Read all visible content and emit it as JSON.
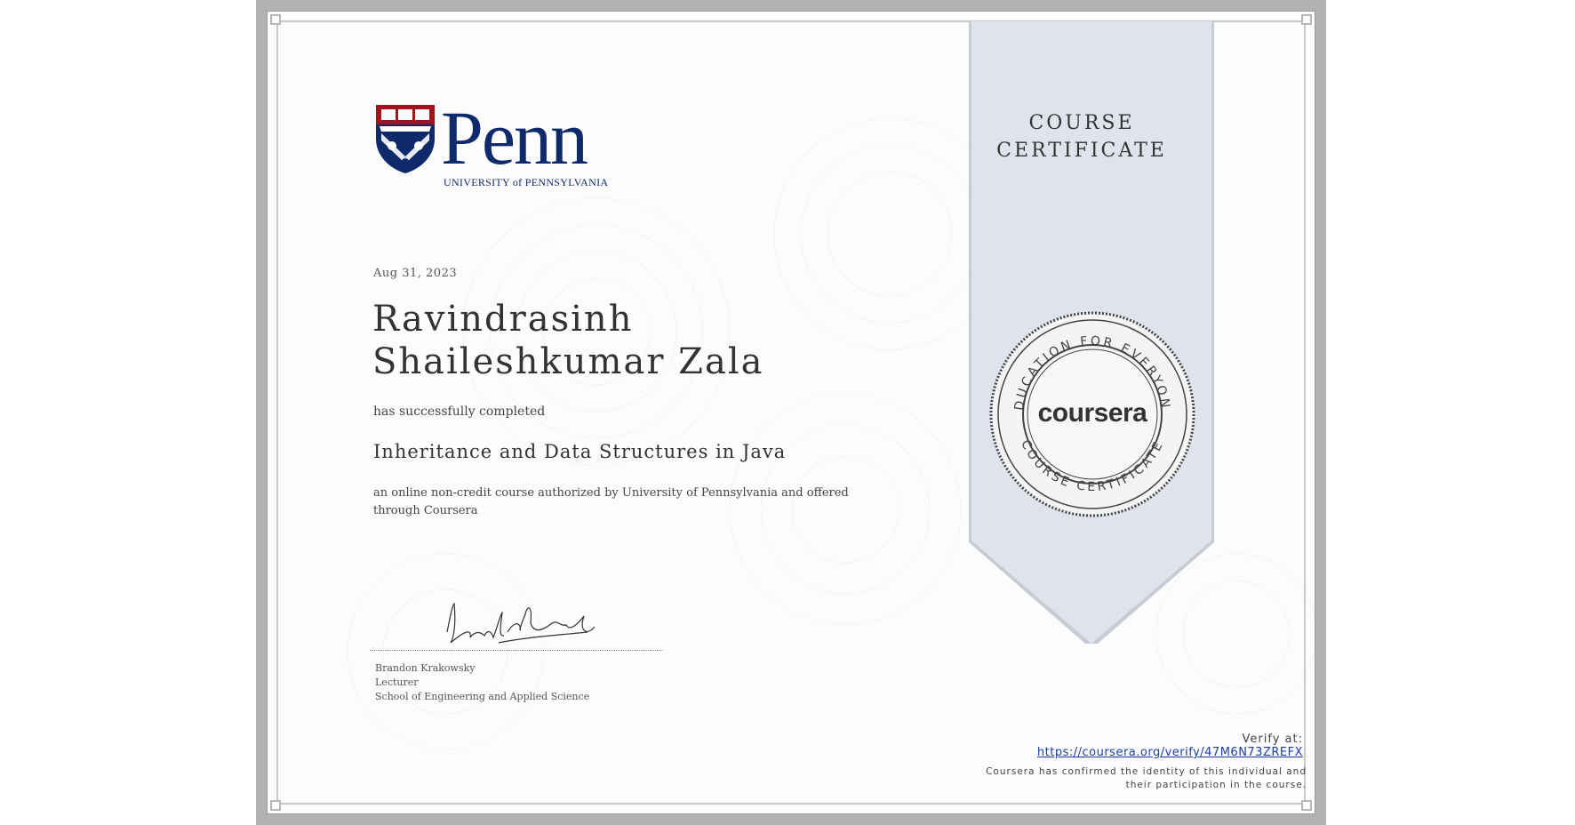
{
  "institution": {
    "logo_word": "Penn",
    "logo_subtitle": "UNIVERSITY of PENNSYLVANIA",
    "shield_colors": {
      "navy": "#0f2a6b",
      "red": "#a1121b"
    }
  },
  "certificate": {
    "issue_date": "Aug 31, 2023",
    "recipient_name": "Ravindrasinh Shaileshkumar Zala",
    "completion_text": "has successfully completed",
    "course_title": "Inheritance and Data Structures in Java",
    "description": "an online non-credit course authorized by University of Pennsylvania and offered through Coursera"
  },
  "signatory": {
    "name": "Brandon Krakowsky",
    "title": "Lecturer",
    "school": "School of Engineering and Applied Science"
  },
  "ribbon": {
    "title_line1": "COURSE",
    "title_line2": "CERTIFICATE",
    "color": "#dfe4ec"
  },
  "seal": {
    "word": "coursera",
    "ring_top": "EDUCATION FOR EVERYONE",
    "ring_bottom": "COURSE CERTIFICATE"
  },
  "verification": {
    "label": "Verify at:",
    "url": "https://coursera.org/verify/47M6N73ZREFX",
    "note_line1": "Coursera has confirmed the identity of this individual and",
    "note_line2": "their participation in the course."
  }
}
